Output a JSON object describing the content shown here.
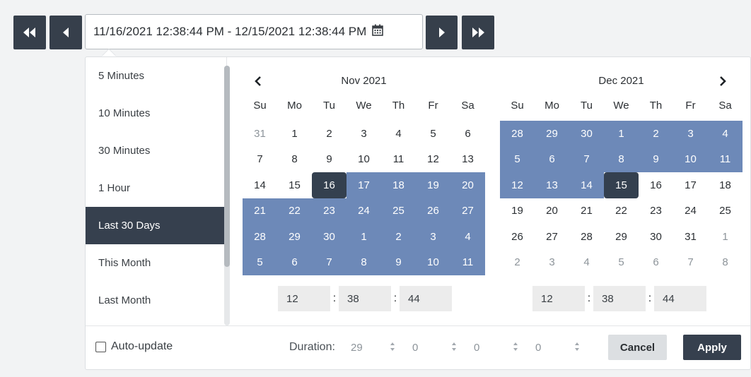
{
  "range_field": {
    "value": "11/16/2021 12:38:44 PM - 12/15/2021 12:38:44 PM"
  },
  "presets": [
    {
      "label": "5 Minutes",
      "active": false
    },
    {
      "label": "10 Minutes",
      "active": false
    },
    {
      "label": "30 Minutes",
      "active": false
    },
    {
      "label": "1 Hour",
      "active": false
    },
    {
      "label": "Last 30 Days",
      "active": true
    },
    {
      "label": "This Month",
      "active": false
    },
    {
      "label": "Last Month",
      "active": false
    }
  ],
  "weekdays": [
    "Su",
    "Mo",
    "Tu",
    "We",
    "Th",
    "Fr",
    "Sa"
  ],
  "calendars": [
    {
      "title": "Nov 2021",
      "weeks": [
        [
          {
            "d": "31",
            "s": "other"
          },
          {
            "d": "1"
          },
          {
            "d": "2"
          },
          {
            "d": "3"
          },
          {
            "d": "4"
          },
          {
            "d": "5"
          },
          {
            "d": "6"
          }
        ],
        [
          {
            "d": "7"
          },
          {
            "d": "8"
          },
          {
            "d": "9"
          },
          {
            "d": "10"
          },
          {
            "d": "11"
          },
          {
            "d": "12"
          },
          {
            "d": "13"
          }
        ],
        [
          {
            "d": "14"
          },
          {
            "d": "15"
          },
          {
            "d": "16",
            "s": "selected"
          },
          {
            "d": "17",
            "s": "in-range"
          },
          {
            "d": "18",
            "s": "in-range"
          },
          {
            "d": "19",
            "s": "in-range"
          },
          {
            "d": "20",
            "s": "in-range"
          }
        ],
        [
          {
            "d": "21",
            "s": "in-range"
          },
          {
            "d": "22",
            "s": "in-range"
          },
          {
            "d": "23",
            "s": "in-range"
          },
          {
            "d": "24",
            "s": "in-range"
          },
          {
            "d": "25",
            "s": "in-range"
          },
          {
            "d": "26",
            "s": "in-range"
          },
          {
            "d": "27",
            "s": "in-range"
          }
        ],
        [
          {
            "d": "28",
            "s": "in-range"
          },
          {
            "d": "29",
            "s": "in-range"
          },
          {
            "d": "30",
            "s": "in-range"
          },
          {
            "d": "1",
            "s": "in-range"
          },
          {
            "d": "2",
            "s": "in-range"
          },
          {
            "d": "3",
            "s": "in-range"
          },
          {
            "d": "4",
            "s": "in-range"
          }
        ],
        [
          {
            "d": "5",
            "s": "in-range"
          },
          {
            "d": "6",
            "s": "in-range"
          },
          {
            "d": "7",
            "s": "in-range"
          },
          {
            "d": "8",
            "s": "in-range"
          },
          {
            "d": "9",
            "s": "in-range"
          },
          {
            "d": "10",
            "s": "in-range"
          },
          {
            "d": "11",
            "s": "in-range"
          }
        ]
      ],
      "time": {
        "hour": "12",
        "minute": "38",
        "second": "44"
      }
    },
    {
      "title": "Dec 2021",
      "weeks": [
        [
          {
            "d": "28",
            "s": "in-range"
          },
          {
            "d": "29",
            "s": "in-range"
          },
          {
            "d": "30",
            "s": "in-range"
          },
          {
            "d": "1",
            "s": "in-range"
          },
          {
            "d": "2",
            "s": "in-range"
          },
          {
            "d": "3",
            "s": "in-range"
          },
          {
            "d": "4",
            "s": "in-range"
          }
        ],
        [
          {
            "d": "5",
            "s": "in-range"
          },
          {
            "d": "6",
            "s": "in-range"
          },
          {
            "d": "7",
            "s": "in-range"
          },
          {
            "d": "8",
            "s": "in-range"
          },
          {
            "d": "9",
            "s": "in-range"
          },
          {
            "d": "10",
            "s": "in-range"
          },
          {
            "d": "11",
            "s": "in-range"
          }
        ],
        [
          {
            "d": "12",
            "s": "in-range"
          },
          {
            "d": "13",
            "s": "in-range"
          },
          {
            "d": "14",
            "s": "in-range"
          },
          {
            "d": "15",
            "s": "selected"
          },
          {
            "d": "16"
          },
          {
            "d": "17"
          },
          {
            "d": "18"
          }
        ],
        [
          {
            "d": "19"
          },
          {
            "d": "20"
          },
          {
            "d": "21"
          },
          {
            "d": "22"
          },
          {
            "d": "23"
          },
          {
            "d": "24"
          },
          {
            "d": "25"
          }
        ],
        [
          {
            "d": "26"
          },
          {
            "d": "27"
          },
          {
            "d": "28"
          },
          {
            "d": "29"
          },
          {
            "d": "30"
          },
          {
            "d": "31"
          },
          {
            "d": "1",
            "s": "other"
          }
        ],
        [
          {
            "d": "2",
            "s": "other"
          },
          {
            "d": "3",
            "s": "other"
          },
          {
            "d": "4",
            "s": "other"
          },
          {
            "d": "5",
            "s": "other"
          },
          {
            "d": "6",
            "s": "other"
          },
          {
            "d": "7",
            "s": "other"
          },
          {
            "d": "8",
            "s": "other"
          }
        ]
      ],
      "time": {
        "hour": "12",
        "minute": "38",
        "second": "44"
      }
    }
  ],
  "footer": {
    "auto_update_label": "Auto-update",
    "auto_update_checked": false,
    "duration_label": "Duration:",
    "duration_values": [
      "29",
      "0",
      "0",
      "0"
    ],
    "cancel_label": "Cancel",
    "apply_label": "Apply"
  },
  "icons": {
    "first": "double-chevron-left-icon",
    "prev": "chevron-left-icon",
    "calendar": "calendar-icon",
    "next": "chevron-right-icon",
    "last": "double-chevron-right-icon"
  },
  "colors": {
    "dark": "#36404e",
    "range": "#6d89b8",
    "selected": "#34404f"
  }
}
